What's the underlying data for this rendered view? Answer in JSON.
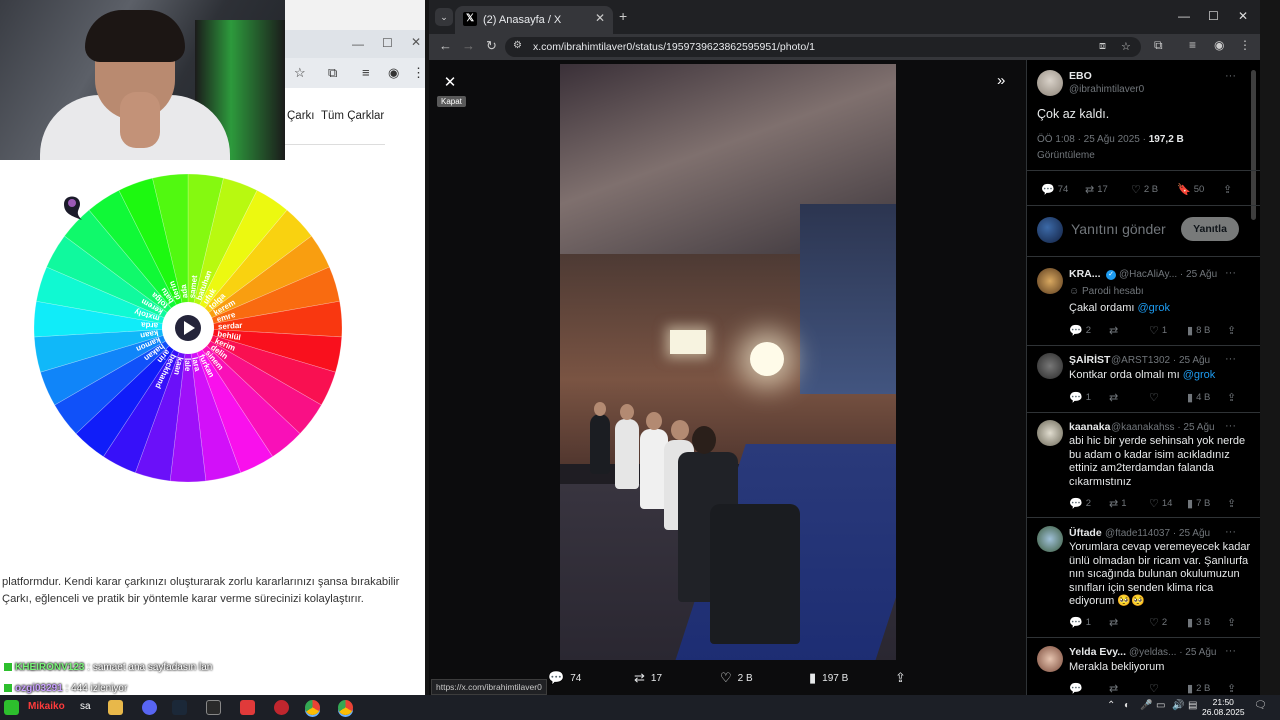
{
  "left_browser": {
    "nav_items": [
      "Çarkı",
      "Tüm Çarklar"
    ],
    "wheel_names": [
      "samet",
      "batuhan",
      "ufuk",
      "tolga",
      "kerem",
      "emre",
      "serdar",
      "behlül",
      "kerim",
      "delin",
      "sinem",
      "furkan",
      "lara",
      "lale",
      "kaan",
      "beckhand",
      "arin",
      "hakan",
      "kamon",
      "kaan",
      "arda",
      "mxtoly",
      "kerem",
      "tolga",
      "batu",
      "derin",
      "ada"
    ],
    "description_lines": [
      "platformdur. Kendi karar çarkınızı oluşturarak zorlu kararlarınızı şansa bırakabilir",
      "Çarkı, eğlenceli ve pratik bir yöntemle karar verme sürecinizi kolaylaştırır."
    ]
  },
  "chat": [
    {
      "user": "KHEIRONV123",
      "message": "samaet ana sayfadasın lan"
    },
    {
      "user": "ozgi03291",
      "message": "444 izleniyor"
    }
  ],
  "browser": {
    "tab_title": "(2) Anasayfa / X",
    "url": "x.com/ibrahimtilaver0/status/1959739623862595951/photo/1"
  },
  "viewer": {
    "close_tooltip": "Kapat",
    "status_url": "https://x.com/ibrahimtilaver0",
    "actions": {
      "replies": "74",
      "reposts": "17",
      "likes": "2 B",
      "views": "197 B"
    }
  },
  "tweet": {
    "author": "EBO",
    "handle": "@ibrahimtilaver0",
    "text": "Çok az kaldı.",
    "time": "ÖÖ 1:08 · 25 Ağu 2025 · ",
    "views_count": "197,2 B",
    "views_label": "Görüntüleme",
    "stats": {
      "replies": "74",
      "reposts": "17",
      "likes": "2 B",
      "bookmarks": "50"
    },
    "reply_placeholder": "Yanıtını gönder",
    "reply_button": "Yanıtla"
  },
  "replies": [
    {
      "name": "KRA...",
      "handle": "@HacAliAy...",
      "date": "· 25 Ağu",
      "badge": "Parodi hesabı",
      "lines": [
        "Çakal ordamı "
      ],
      "mention": "@grok",
      "stats": [
        "2",
        "",
        "1",
        "8 B"
      ]
    },
    {
      "name": "ŞAİRİST",
      "handle": "@ARST1302",
      "date": "· 25 Ağu",
      "lines": [
        "Kontkar orda olmalı mı "
      ],
      "mention": "@grok",
      "stats": [
        "1",
        "",
        "",
        "4 B"
      ]
    },
    {
      "name": "kaanaka",
      "handle": "@kaanakahss",
      "date": "· 25 Ağu",
      "lines": [
        "abi hic bir yerde sehinsah yok nerde",
        "bu adam o kadar isim acıkladınız",
        "ettiniz am2terdamdan falanda",
        "cıkarmıstınız"
      ],
      "stats": [
        "2",
        "1",
        "14",
        "7 B"
      ]
    },
    {
      "name": "Üftade",
      "handle": "@ftade114037",
      "date": "· 25 Ağu",
      "lines": [
        "Yorumlara cevap veremeyecek kadar",
        "ünlü olmadan bir ricam var. Şanlıurfa",
        "nın sıcağında bulunan okulumuzun",
        "sınıfları için senden klima rica",
        "ediyorum 🥺🥺"
      ],
      "stats": [
        "1",
        "",
        "2",
        "3 B"
      ]
    },
    {
      "name": "Yelda Evy...",
      "handle": "@yeldas...",
      "date": "· 25 Ağu",
      "lines": [
        "Merakla bekliyorum"
      ],
      "stats": [
        "",
        "",
        "",
        "2 B"
      ]
    }
  ],
  "taskbar": {
    "user_label": "Mikaiko",
    "user_suffix": "sa",
    "time": "21:50",
    "date": "26.08.2025"
  },
  "colors": {
    "x_background": "#000000",
    "accent": "#1d9bf0",
    "muted": "#71767b",
    "chat_user": "#7af27a"
  }
}
